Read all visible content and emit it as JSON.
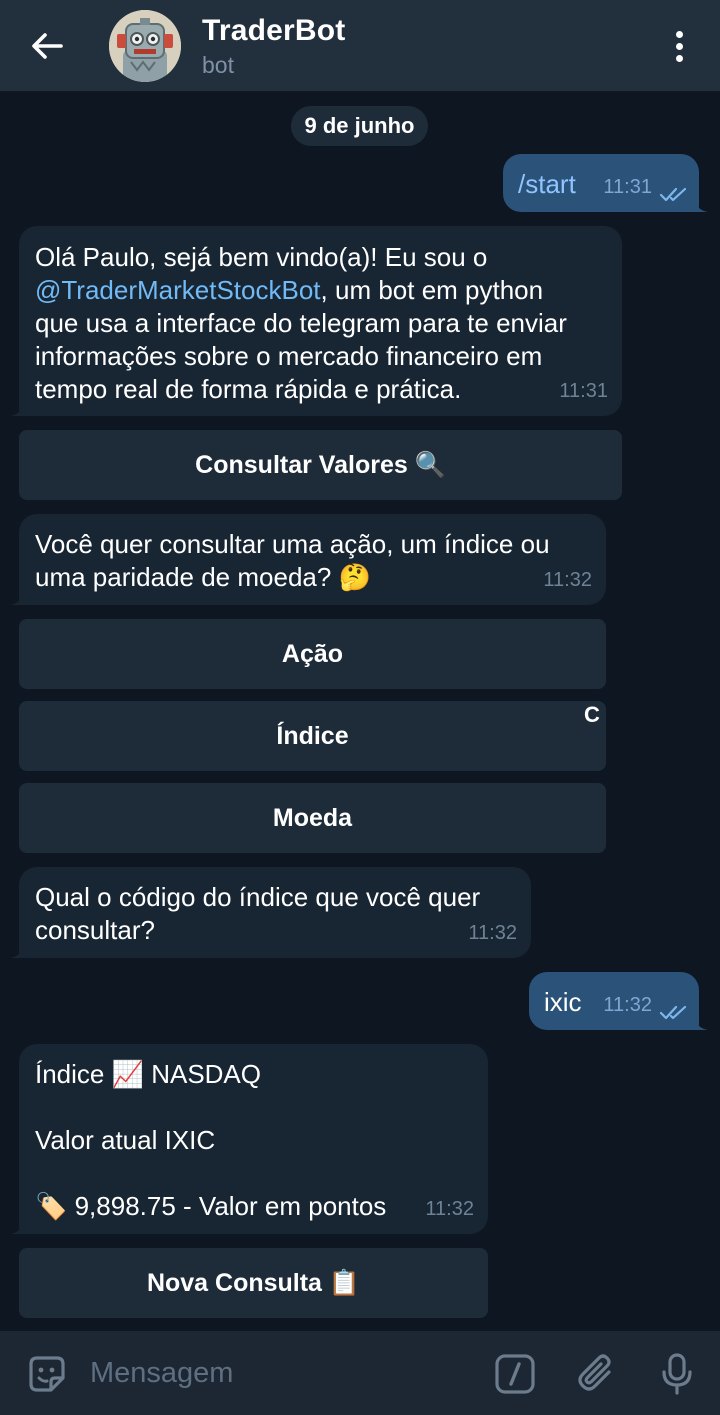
{
  "header": {
    "title": "TraderBot",
    "subtitle": "bot"
  },
  "chat": {
    "date": "9 de junho",
    "messages": {
      "m1": {
        "text": "/start",
        "time": "11:31"
      },
      "m2": {
        "line1": "Olá Paulo, sejá bem vindo(a)! Eu sou o",
        "link": "@TraderMarketStockBot",
        "line2_rest": ", um bot em python",
        "line3": "que usa a interface do telegram para te enviar",
        "line4": "informações sobre o mercado financeiro em",
        "line5": "tempo real de forma rápida e prática.",
        "time": "11:31"
      },
      "m3": {
        "line1": "Você quer consultar uma ação, um índice ou",
        "line2": "uma paridade de moeda? 🤔",
        "time": "11:32"
      },
      "m4": {
        "line1": "Qual o código do índice que você quer",
        "line2": "consultar?",
        "time": "11:32"
      },
      "m5": {
        "text": "ixic",
        "time": "11:32"
      },
      "m6": {
        "line1": "Índice 📈 NASDAQ",
        "line2": "Valor atual IXIC",
        "line3": "🏷️ 9,898.75 - Valor em pontos",
        "time": "11:32"
      }
    },
    "buttons": {
      "consultar": "Consultar Valores 🔍",
      "acao": "Ação",
      "indice": "Índice",
      "moeda": "Moeda",
      "nova": "Nova Consulta 📋"
    },
    "loading_indicator": "C"
  },
  "composer": {
    "placeholder": "Mensagem"
  },
  "icons": {
    "back": "arrow-left",
    "menu": "more-vertical",
    "emoji": "sticker-smile",
    "commands": "slash-command",
    "attach": "paperclip",
    "mic": "microphone",
    "read": "double-check"
  },
  "colors": {
    "background": "#0e1621",
    "header": "#222f3d",
    "incoming": "#182533",
    "outgoing": "#2b5278",
    "link": "#71baf6",
    "keyboard_button": "#1e2c3a"
  }
}
